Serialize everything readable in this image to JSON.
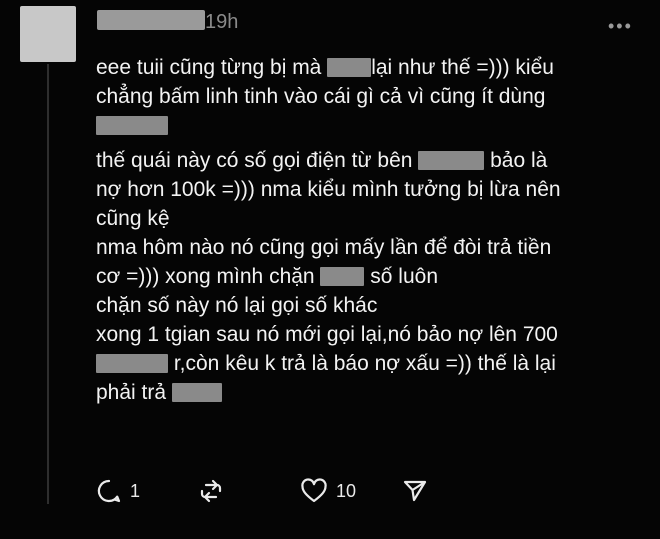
{
  "post": {
    "time": "19h",
    "more_label": "•••",
    "lines": [
      [
        "eee tuii cũng từng bị mà ",
        "[redacted]",
        "lại như thế =))) kiểu"
      ],
      [
        "chẳng bấm linh tinh vào cái gì cả vì cũng ít dùng"
      ],
      [
        "[redacted]"
      ],
      [
        "thế quái này có số gọi điện từ bên ",
        "[redacted]",
        " bảo là"
      ],
      [
        "nợ hơn 100k =))) nma kiểu mình tưởng bị lừa nên"
      ],
      [
        "cũng kệ"
      ],
      [
        "nma hôm nào nó cũng gọi mấy lần để đòi trả tiền"
      ],
      [
        "cơ =))) xong mình chặn ",
        "[redacted]",
        " số luôn"
      ],
      [
        "chặn số này nó lại gọi số khác"
      ],
      [
        "xong 1 tgian sau nó mới gọi lại,nó bảo nợ lên 700"
      ],
      [
        "[redacted]",
        " r,còn kêu k trả là báo nợ xấu =)) thế là lại"
      ],
      [
        "phải trả ",
        "[redacted]"
      ]
    ],
    "t": {
      "l1a": "eee tuii cũng từng bị mà ",
      "l1b": "lại như thế =))) kiểu",
      "l2": "chẳng bấm linh tinh vào cái gì cả vì cũng ít dùng",
      "l4a": "thế quái này có số gọi điện từ bên ",
      "l4b": " bảo là",
      "l5": "nợ hơn 100k =))) nma kiểu mình tưởng bị lừa nên",
      "l6": "cũng kệ",
      "l7": "nma hôm nào nó cũng gọi mấy lần để đòi trả tiền",
      "l8a": "cơ =))) xong mình chặn ",
      "l8b": " số luôn",
      "l9": "chặn số này nó lại gọi số khác",
      "l10": "xong 1 tgian sau nó mới gọi lại,nó bảo nợ lên 700",
      "l11b": " r,còn kêu k trả là báo nợ xấu =)) thế là lại",
      "l12a": "phải trả "
    }
  },
  "actions": {
    "reply_count": "1",
    "like_count": "10",
    "icons": [
      "comment-icon",
      "repost-icon",
      "heart-icon",
      "send-icon"
    ]
  },
  "colors": {
    "background": "#050505",
    "text": "#f3f3f3",
    "muted": "#8a8a8a",
    "redaction": "#8a8a8a"
  }
}
